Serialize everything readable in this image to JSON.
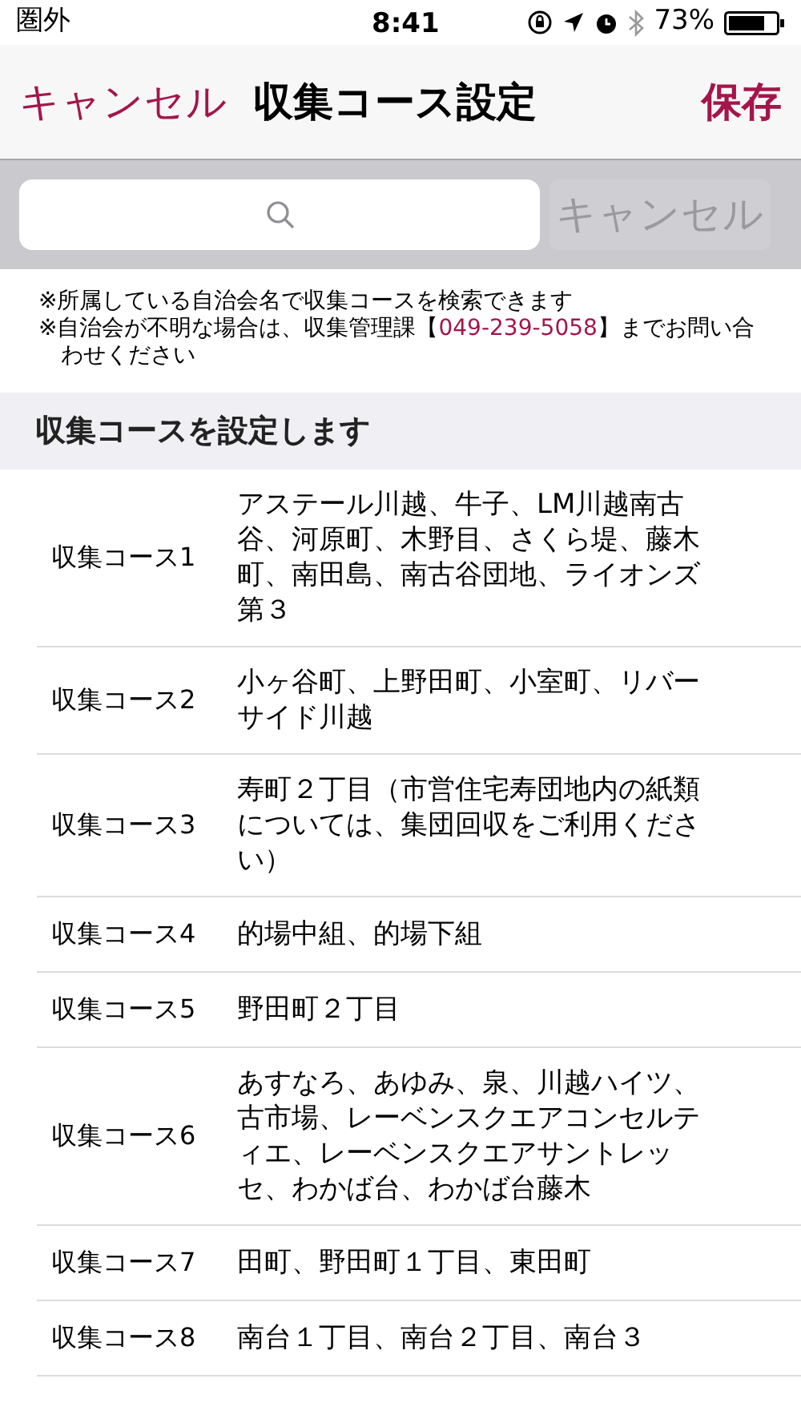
{
  "status_bar": {
    "carrier": "圏外",
    "time": "8:41",
    "battery": "73%"
  },
  "nav": {
    "cancel": "キャンセル",
    "title": "収集コース設定",
    "save": "保存"
  },
  "search": {
    "cancel": "キャンセル"
  },
  "notes": [
    {
      "before": "※所属している自治会名で収集コースを検索できます"
    },
    {
      "before": "※自治会が不明な場合は、収集管理課【",
      "phone": "049-239-5058",
      "after": "】までお問い合わせください"
    }
  ],
  "section": {
    "title": "収集コースを設定します"
  },
  "courses": [
    {
      "name": "収集コース1",
      "areas": "アステール川越、牛子、LM川越南古谷、河原町、木野目、さくら堤、藤木町、南田島、南古谷団地、ライオンズ第３"
    },
    {
      "name": "収集コース2",
      "areas": "小ヶ谷町、上野田町、小室町、リバーサイド川越"
    },
    {
      "name": "収集コース3",
      "areas": "寿町２丁目（市営住宅寿団地内の紙類については、集団回収をご利用ください）"
    },
    {
      "name": "収集コース4",
      "areas": "的場中組、的場下組"
    },
    {
      "name": "収集コース5",
      "areas": "野田町２丁目"
    },
    {
      "name": "収集コース6",
      "areas": "あすなろ、あゆみ、泉、川越ハイツ、古市場、レーベンスクエアコンセルティエ、レーベンスクエアサントレッセ、わかば台、わかば台藤木"
    },
    {
      "name": "収集コース7",
      "areas": "田町、野田町１丁目、東田町"
    },
    {
      "name": "収集コース8",
      "areas": "南台１丁目、南台２丁目、南台３"
    }
  ]
}
